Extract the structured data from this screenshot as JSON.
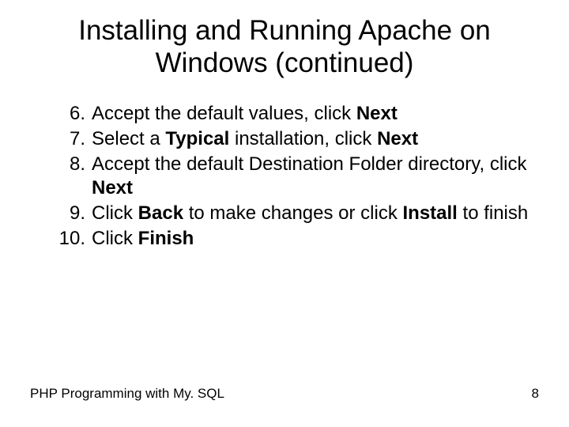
{
  "title": "Installing and Running Apache on Windows (continued)",
  "steps": [
    {
      "pre": "Accept the default values, click ",
      "b1": "Next",
      "mid": "",
      "b2": "",
      "post": ""
    },
    {
      "pre": "Select a ",
      "b1": "Typical",
      "mid": " installation, click ",
      "b2": "Next",
      "post": ""
    },
    {
      "pre": "Accept the default Destination Folder directory, click ",
      "b1": "Next",
      "mid": "",
      "b2": "",
      "post": ""
    },
    {
      "pre": "Click ",
      "b1": "Back",
      "mid": " to make changes or click ",
      "b2": "Install",
      "post": " to finish"
    },
    {
      "pre": "Click ",
      "b1": "Finish",
      "mid": "",
      "b2": "",
      "post": ""
    }
  ],
  "footer": {
    "source": "PHP Programming with My. SQL",
    "page": "8"
  }
}
